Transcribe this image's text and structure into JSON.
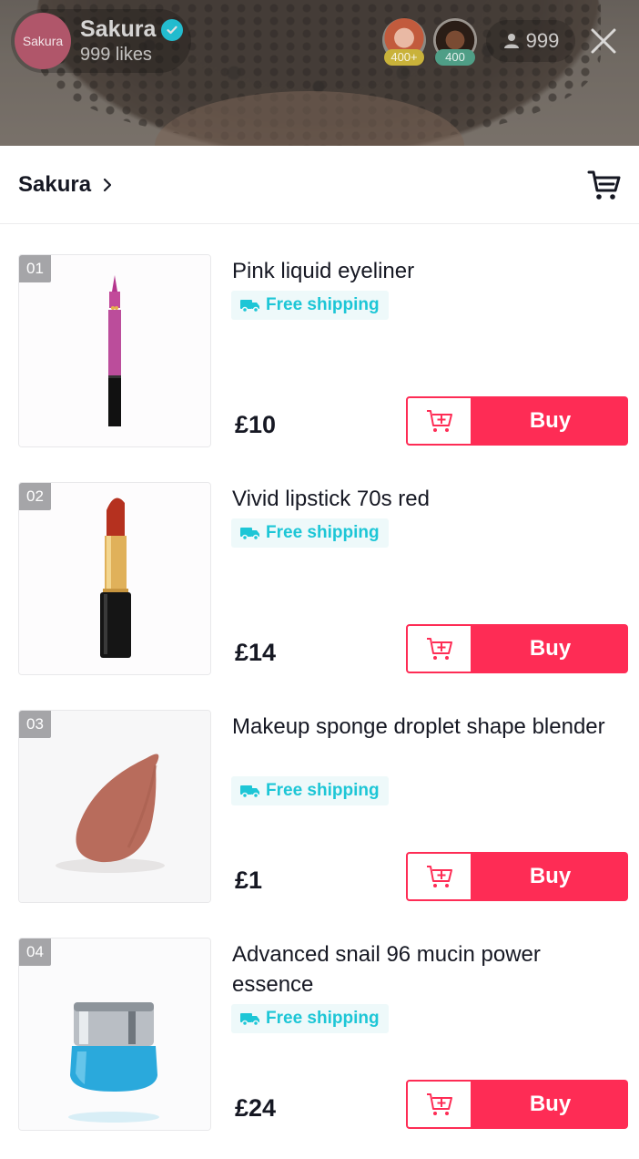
{
  "live": {
    "host_avatar_text": "Sakura",
    "host_name": "Sakura",
    "likes": "999 likes",
    "viewers": [
      {
        "badge": "400+",
        "badge_color": "#c9b23a"
      },
      {
        "badge": "400",
        "badge_color": "#4f9e86"
      }
    ],
    "viewer_count": "999"
  },
  "shop": {
    "name": "Sakura"
  },
  "colors": {
    "accent": "#fe2c55",
    "shipping": "#1dc6d6",
    "verified": "#20d5ec"
  },
  "products": [
    {
      "index": "01",
      "title": "Pink liquid eyeliner",
      "shipping": "Free shipping",
      "price": "£10",
      "buy_label": "Buy",
      "image": "eyeliner-image"
    },
    {
      "index": "02",
      "title": "Vivid lipstick 70s red",
      "shipping": "Free shipping",
      "price": "£14",
      "buy_label": "Buy",
      "image": "lipstick-image"
    },
    {
      "index": "03",
      "title": "Makeup sponge droplet shape blender",
      "shipping": "Free shipping",
      "price": "£1",
      "buy_label": "Buy",
      "image": "sponge-image"
    },
    {
      "index": "04",
      "title": "Advanced snail 96 mucin power essence",
      "shipping": "Free shipping",
      "price": "£24",
      "buy_label": "Buy",
      "image": "cream-jar-image"
    }
  ]
}
